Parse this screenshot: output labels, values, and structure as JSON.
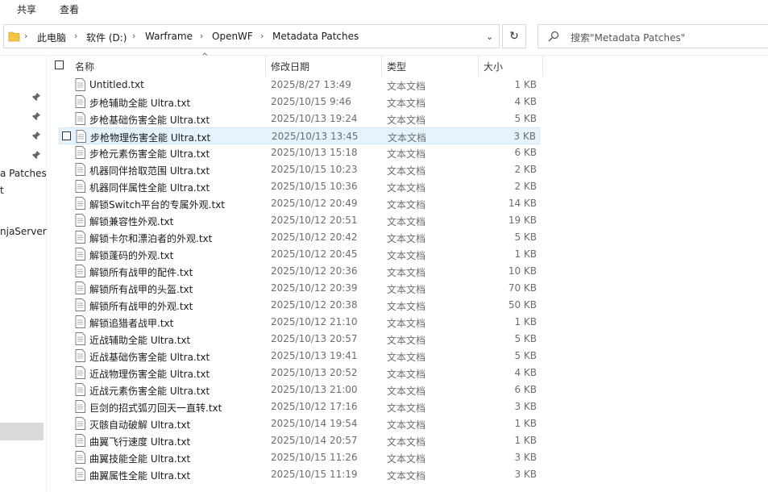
{
  "ribbon": {
    "share": "共享",
    "view": "查看"
  },
  "address": {
    "crumbs": [
      "此电脑",
      "软件 (D:)",
      "Warframe",
      "OpenWF",
      "Metadata Patches"
    ],
    "separator": "›"
  },
  "search": {
    "placeholder": "搜索\"Metadata Patches\""
  },
  "nav": {
    "items": [
      "a Patches",
      "t",
      "njaServer"
    ]
  },
  "columns": {
    "name": "名称",
    "date": "修改日期",
    "type": "类型",
    "size": "大小"
  },
  "files": [
    {
      "name": "Untitled.txt",
      "date": "2025/8/27 13:49",
      "type": "文本文档",
      "size": "1 KB"
    },
    {
      "name": "步枪辅助全能 Ultra.txt",
      "date": "2025/10/15 9:46",
      "type": "文本文档",
      "size": "4 KB"
    },
    {
      "name": "步枪基础伤害全能 Ultra.txt",
      "date": "2025/10/13 19:24",
      "type": "文本文档",
      "size": "5 KB"
    },
    {
      "name": "步枪物理伤害全能 Ultra.txt",
      "date": "2025/10/13 13:45",
      "type": "文本文档",
      "size": "3 KB"
    },
    {
      "name": "步枪元素伤害全能 Ultra.txt",
      "date": "2025/10/13 15:18",
      "type": "文本文档",
      "size": "6 KB"
    },
    {
      "name": "机器同伴拾取范围 Ultra.txt",
      "date": "2025/10/15 10:23",
      "type": "文本文档",
      "size": "2 KB"
    },
    {
      "name": "机器同伴属性全能 Ultra.txt",
      "date": "2025/10/15 10:36",
      "type": "文本文档",
      "size": "2 KB"
    },
    {
      "name": "解锁Switch平台的专属外观.txt",
      "date": "2025/10/12 20:49",
      "type": "文本文档",
      "size": "14 KB"
    },
    {
      "name": "解锁兼容性外观.txt",
      "date": "2025/10/12 20:51",
      "type": "文本文档",
      "size": "19 KB"
    },
    {
      "name": "解锁卡尔和漂泊者的外观.txt",
      "date": "2025/10/12 20:42",
      "type": "文本文档",
      "size": "5 KB"
    },
    {
      "name": "解锁蓬码的外观.txt",
      "date": "2025/10/12 20:45",
      "type": "文本文档",
      "size": "1 KB"
    },
    {
      "name": "解锁所有战甲的配件.txt",
      "date": "2025/10/12 20:36",
      "type": "文本文档",
      "size": "10 KB"
    },
    {
      "name": "解锁所有战甲的头盔.txt",
      "date": "2025/10/12 20:39",
      "type": "文本文档",
      "size": "70 KB"
    },
    {
      "name": "解锁所有战甲的外观.txt",
      "date": "2025/10/12 20:38",
      "type": "文本文档",
      "size": "50 KB"
    },
    {
      "name": "解锁追猎者战甲.txt",
      "date": "2025/10/12 21:10",
      "type": "文本文档",
      "size": "1 KB"
    },
    {
      "name": "近战辅助全能 Ultra.txt",
      "date": "2025/10/13 20:57",
      "type": "文本文档",
      "size": "5 KB"
    },
    {
      "name": "近战基础伤害全能 Ultra.txt",
      "date": "2025/10/13 19:41",
      "type": "文本文档",
      "size": "5 KB"
    },
    {
      "name": "近战物理伤害全能 Ultra.txt",
      "date": "2025/10/13 20:52",
      "type": "文本文档",
      "size": "4 KB"
    },
    {
      "name": "近战元素伤害全能 Ultra.txt",
      "date": "2025/10/13 21:00",
      "type": "文本文档",
      "size": "6 KB"
    },
    {
      "name": "巨剑的招式弧刃回天一直转.txt",
      "date": "2025/10/12 17:16",
      "type": "文本文档",
      "size": "3 KB"
    },
    {
      "name": "灭骸自动破解 Ultra.txt",
      "date": "2025/10/14 19:54",
      "type": "文本文档",
      "size": "1 KB"
    },
    {
      "name": "曲翼飞行速度 Ultra.txt",
      "date": "2025/10/14 20:57",
      "type": "文本文档",
      "size": "1 KB"
    },
    {
      "name": "曲翼技能全能 Ultra.txt",
      "date": "2025/10/15 11:26",
      "type": "文本文档",
      "size": "3 KB"
    },
    {
      "name": "曲翼属性全能 Ultra.txt",
      "date": "2025/10/15 11:19",
      "type": "文本文档",
      "size": "3 KB"
    }
  ],
  "selected_index": 3
}
